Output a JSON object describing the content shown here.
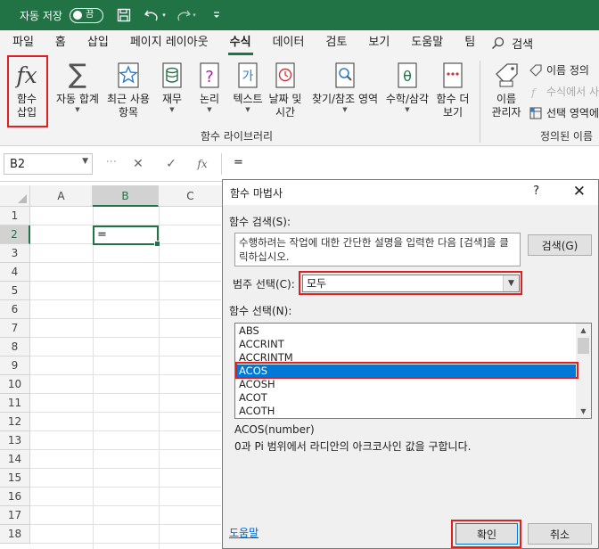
{
  "titlebar": {
    "autosave_label": "자동 저장",
    "autosave_state": "끔",
    "icons": [
      "save-icon",
      "undo-icon",
      "redo-icon",
      "customize-icon"
    ]
  },
  "menu": {
    "tabs": [
      "파일",
      "홈",
      "삽입",
      "페이지 레이아웃",
      "수식",
      "데이터",
      "검토",
      "보기",
      "도움말",
      "팀"
    ],
    "active": "수식",
    "search_label": "검색"
  },
  "ribbon": {
    "insert_function": "함수\n삽입",
    "autosum": "자동 합계",
    "recent": "최근 사용\n항목",
    "financial": "재무",
    "logical": "논리",
    "text": "텍스트",
    "datetime": "날짜 및\n시간",
    "lookup": "찾기/참조 영역",
    "math": "수학/삼각",
    "more": "함수 더\n보기",
    "library_group": "함수 라이브러리",
    "name_manager": "이름\n관리자",
    "define_name": "이름 정의",
    "use_in_formula": "수식에서 사",
    "create_from_selection": "선택 영역에",
    "defined_names_group": "정의된 이름",
    "icon_color": "#217346"
  },
  "formula_bar": {
    "name_box": "B2",
    "fx_label": "fx",
    "content": "="
  },
  "grid": {
    "columns": [
      "A",
      "B",
      "C"
    ],
    "rows": [
      "1",
      "2",
      "3",
      "4",
      "5",
      "6",
      "7",
      "8",
      "9",
      "10",
      "11",
      "12",
      "13",
      "14",
      "15",
      "16",
      "17",
      "18"
    ],
    "active_cell": "B2",
    "active_value": "="
  },
  "dialog": {
    "title": "함수 마법사",
    "help_q": "?",
    "close": "✕",
    "search_label": "함수 검색(S):",
    "search_desc": "수행하려는 작업에 대한 간단한 설명을 입력한 다음 [검색]을 클릭하십시오.",
    "search_button": "검색(G)",
    "category_label": "범주 선택(C):",
    "category_value": "모두",
    "function_label": "함수 선택(N):",
    "functions": [
      "ABS",
      "ACCRINT",
      "ACCRINTM",
      "ACOS",
      "ACOSH",
      "ACOT",
      "ACOTH"
    ],
    "selected_function": "ACOS",
    "syntax": "ACOS(number)",
    "description": "0과 Pi 범위에서 라디안의 아크코사인 값을 구합니다.",
    "help_link": "도움말",
    "ok_button": "확인",
    "cancel_button": "취소",
    "selection_color": "#0078d7",
    "highlight_color": "#e02020"
  }
}
